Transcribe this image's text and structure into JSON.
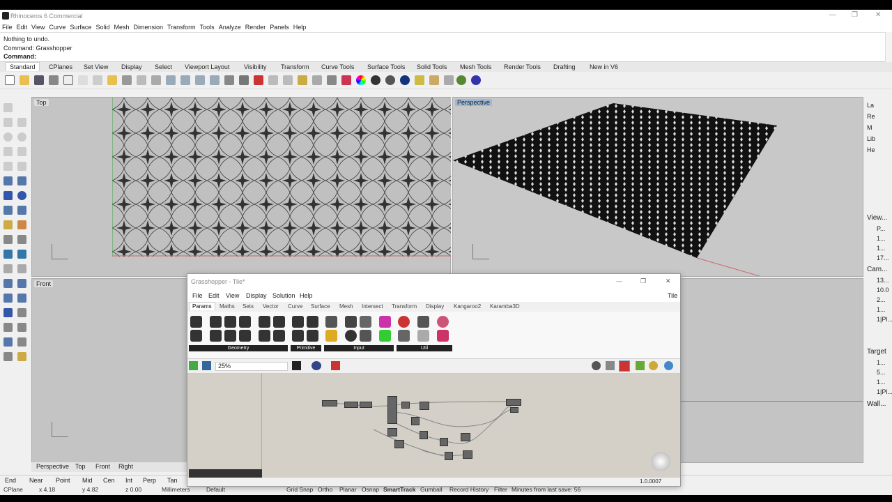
{
  "app": {
    "title": "Rhinoceros 6 Commercial",
    "win_controls": [
      "—",
      "❐",
      "✕"
    ]
  },
  "menu": [
    "File",
    "Edit",
    "View",
    "Curve",
    "Surface",
    "Solid",
    "Mesh",
    "Dimension",
    "Transform",
    "Tools",
    "Analyze",
    "Render",
    "Panels",
    "Help"
  ],
  "command": {
    "lines": [
      "Nothing to undo.",
      "Command: Grasshopper"
    ],
    "prompt": "Command:"
  },
  "toolbar_tabs": [
    "Standard",
    "CPlanes",
    "Set View",
    "Display",
    "Select",
    "Viewport Layout",
    "Visibility",
    "Transform",
    "Curve Tools",
    "Surface Tools",
    "Solid Tools",
    "Mesh Tools",
    "Render Tools",
    "Drafting",
    "New in V6"
  ],
  "viewports": {
    "top": "Top",
    "perspective": "Perspective",
    "front": "Front"
  },
  "viewport_tabs": [
    "Perspective",
    "Top",
    "Front",
    "Right"
  ],
  "right_panel": {
    "tabs": [
      "La",
      "Re",
      "M",
      "Lib",
      "He"
    ],
    "view_label": "View...",
    "camera_label": "Cam...",
    "target_label": "Target",
    "wall_label": "Wall...",
    "values": [
      "P...",
      "1...",
      "1...",
      "17...",
      "13...",
      "10.0",
      "2...",
      "1...",
      "1|Pl...",
      "1...",
      "5...",
      "1...",
      "1|Pl..."
    ]
  },
  "osnaps": [
    "End",
    "Near",
    "Point",
    "Mid",
    "Cen",
    "Int",
    "Perp",
    "Tan"
  ],
  "status": {
    "plane": "CPlane",
    "x": "x 4.18",
    "y": "y 4.82",
    "z": "z 0.00",
    "units": "Millimeters",
    "layer": "Default",
    "items": [
      "Grid Snap",
      "Ortho",
      "Planar",
      "Osnap",
      "SmartTrack",
      "Gumball",
      "Record History",
      "Filter"
    ],
    "save": "Minutes from last save: 56"
  },
  "grasshopper": {
    "title": "Grasshopper - Tile*",
    "win_controls": [
      "—",
      "❐",
      "✕"
    ],
    "menu": [
      "File",
      "Edit",
      "View",
      "Display",
      "Solution",
      "Help"
    ],
    "doc_name": "Tile",
    "tabs": [
      "Params",
      "Maths",
      "Sets",
      "Vector",
      "Curve",
      "Surface",
      "Mesh",
      "Intersect",
      "Transform",
      "Display",
      "Kangaroo2",
      "Karamba3D"
    ],
    "groups": [
      "Geometry",
      "Primitive",
      "Input",
      "Util"
    ],
    "zoom": "25%",
    "version": "1.0.0007"
  }
}
